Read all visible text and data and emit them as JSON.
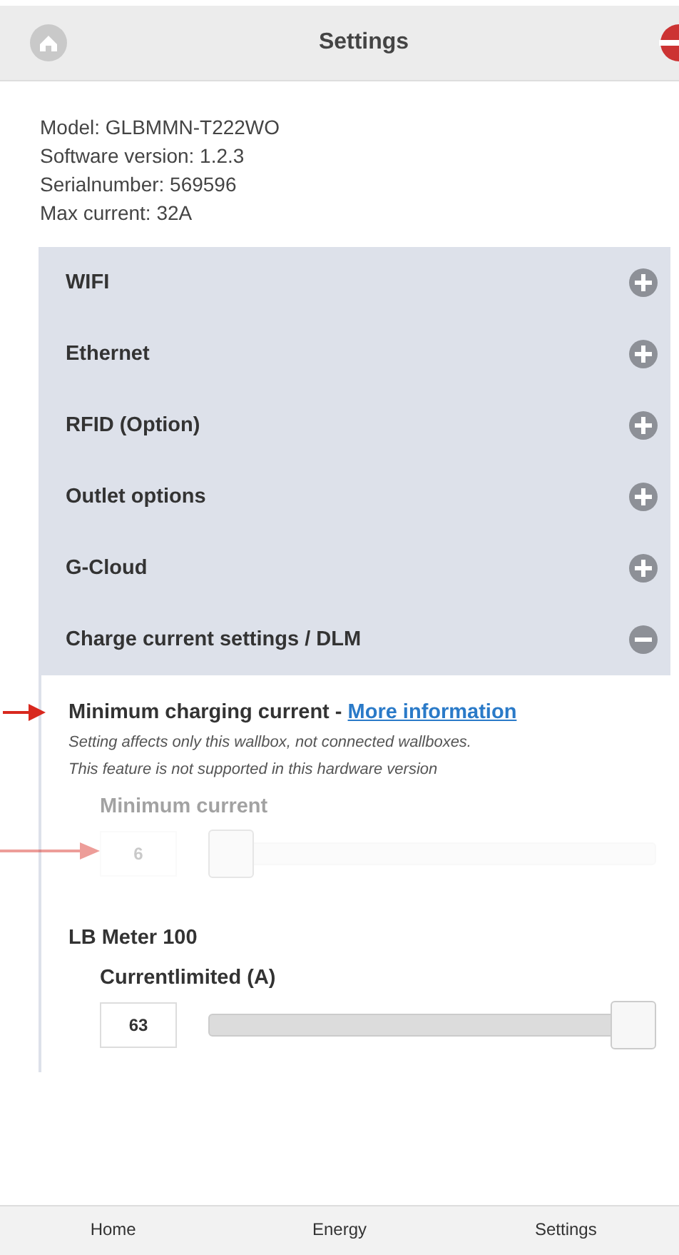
{
  "header": {
    "title": "Settings"
  },
  "info": [
    "Model: GLBMMN-T222WO",
    "Software version: 1.2.3",
    "Serialnumber: 569596",
    "Max current: 32A"
  ],
  "sections": [
    {
      "label": "WIFI",
      "expanded": false
    },
    {
      "label": "Ethernet",
      "expanded": false
    },
    {
      "label": "RFID (Option)",
      "expanded": false
    },
    {
      "label": "Outlet options",
      "expanded": false
    },
    {
      "label": "G-Cloud",
      "expanded": false
    },
    {
      "label": "Charge current settings / DLM",
      "expanded": true
    }
  ],
  "charge_settings": {
    "heading": "Minimum charging current - ",
    "link": "More information",
    "notes": [
      "Setting affects only this wallbox, not connected wallboxes.",
      "This feature is not supported in this hardware version"
    ],
    "sliders": [
      {
        "label": "Minimum current",
        "value": "6",
        "level": 0,
        "disabled": true
      },
      {
        "group": "LB Meter 100",
        "label": "Currentlimited (A)",
        "value": "63",
        "level": 1,
        "disabled": false
      }
    ]
  },
  "bottom_nav": [
    {
      "label": "Home"
    },
    {
      "label": "Energy"
    },
    {
      "label": "Settings"
    }
  ]
}
